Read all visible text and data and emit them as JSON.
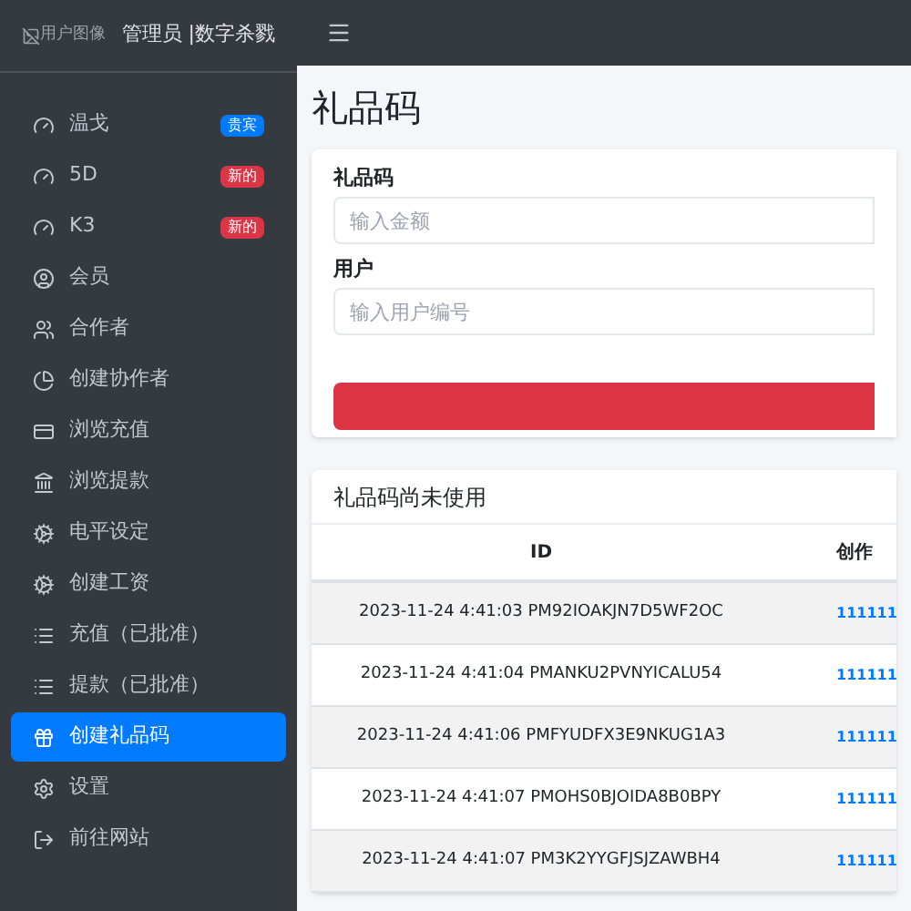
{
  "brand": {
    "logo_alt": "用户图像",
    "title": "管理员 |数字杀戮"
  },
  "sidebar": {
    "items": [
      {
        "label": "温戈",
        "badge": "贵宾",
        "color": "#007bff",
        "selected": false
      },
      {
        "label": "5D",
        "badge": "新的",
        "color": "#dc3545",
        "selected": false
      },
      {
        "label": "K3",
        "badge": "新的",
        "color": "#dc3545",
        "selected": false
      },
      {
        "label": "会员",
        "selected": false
      },
      {
        "label": "合作者",
        "selected": false
      },
      {
        "label": "创建协作者",
        "selected": false
      },
      {
        "label": "浏览充值",
        "selected": false
      },
      {
        "label": "浏览提款",
        "selected": false
      },
      {
        "label": "电平设定",
        "selected": false
      },
      {
        "label": "创建工资",
        "selected": false
      },
      {
        "label": "充值（已批准）",
        "selected": false
      },
      {
        "label": "提款（已批准）",
        "selected": false
      },
      {
        "label": "创建礼品码",
        "selected": true
      },
      {
        "label": "设置",
        "selected": false
      },
      {
        "label": "前往网站",
        "selected": false
      }
    ]
  },
  "page_title": "礼品码",
  "form": {
    "fields": [
      {
        "label": "礼品码",
        "placeholder": "输入金额"
      },
      {
        "label": "用户",
        "placeholder": "输入用户编号"
      }
    ]
  },
  "table": {
    "title": "礼品码尚未使用",
    "columns": [
      "ID",
      "创作"
    ],
    "rows": [
      [
        "2023-11-24 4:41:03 PM92IOAKJN7D5WF2OC",
        "111111"
      ],
      [
        "2023-11-24 4:41:04 PMANKU2PVNYICALU54",
        "111111"
      ],
      [
        "2023-11-24 4:41:06 PMFYUDFX3E9NKUG1A3",
        "111111"
      ],
      [
        "2023-11-24 4:41:07 PMOHS0BJOIDA8B0BPY",
        "111111"
      ],
      [
        "2023-11-24 4:41:07 PM3K2YYGFJSJZAWBH4",
        "111111"
      ]
    ]
  }
}
